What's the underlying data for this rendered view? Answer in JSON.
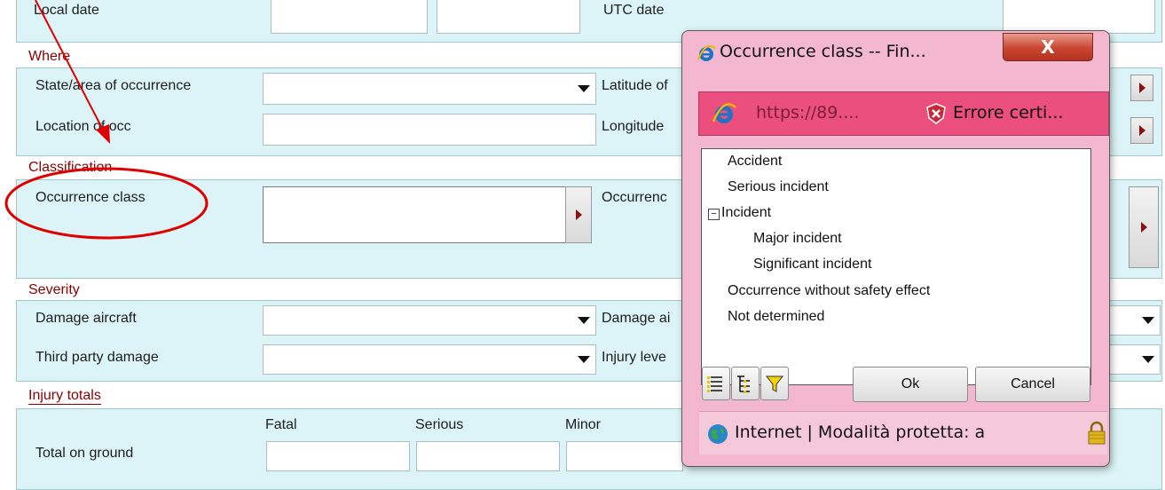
{
  "form": {
    "top_labels": {
      "local_date": "Local date",
      "utc_date": "UTC date"
    },
    "where": {
      "section": "Where",
      "state_label": "State/area of occurrence",
      "lat_label": "Latitude of",
      "location_label": "Location of occ",
      "long_label": "Longitude"
    },
    "classification": {
      "section": "Classification",
      "occ_class_label": "Occurrence class",
      "occ_cat_label": "Occurrenc"
    },
    "severity": {
      "section": "Severity",
      "damage_aircraft_label": "Damage aircraft",
      "damage_a_label": "Damage ai",
      "third_party_label": "Third party damage",
      "injury_level_label": "Injury leve"
    },
    "injury": {
      "section": "Injury totals",
      "col_fatal": "Fatal",
      "col_serious": "Serious",
      "col_minor": "Minor",
      "row_ground": "Total on ground"
    }
  },
  "popup": {
    "title": "Occurrence class -- Fin...",
    "close_label": "X",
    "url": "https://89....",
    "cert_error": "Errore certi...",
    "tree": [
      {
        "label": "Accident"
      },
      {
        "label": "Serious incident"
      },
      {
        "label": "Incident"
      },
      {
        "label": "Major incident"
      },
      {
        "label": "Significant incident"
      },
      {
        "label": "Occurrence without safety effect"
      },
      {
        "label": "Not determined"
      }
    ],
    "expander": "−",
    "ok_label": "Ok",
    "cancel_label": "Cancel",
    "status": "Internet | Modalità protetta: a"
  },
  "colors": {
    "panel": "#dcf4f7",
    "section": "#8b0000",
    "popup": "#f3b7cf",
    "annotation": "#e00000"
  }
}
